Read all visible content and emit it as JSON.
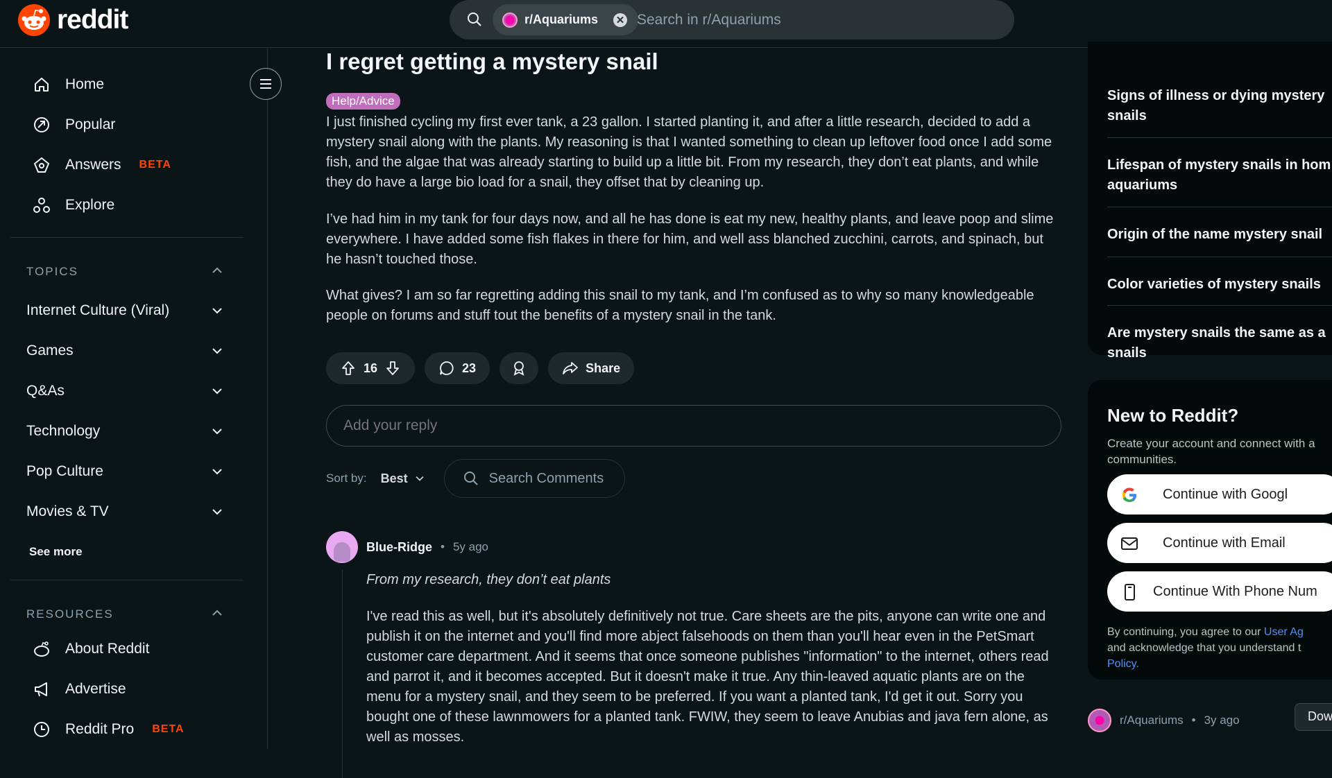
{
  "header": {
    "logo_text": "reddit",
    "search_chip": "r/Aquariums",
    "search_placeholder": "Search in r/Aquariums"
  },
  "sidebar": {
    "nav": [
      {
        "label": "Home",
        "icon": "home-icon"
      },
      {
        "label": "Popular",
        "icon": "popular-icon"
      },
      {
        "label": "Answers",
        "badge": "BETA",
        "icon": "answers-icon"
      },
      {
        "label": "Explore",
        "icon": "explore-icon"
      }
    ],
    "topics_title": "TOPICS",
    "topics": [
      "Internet Culture (Viral)",
      "Games",
      "Q&As",
      "Technology",
      "Pop Culture",
      "Movies & TV"
    ],
    "see_more": "See more",
    "resources_title": "RESOURCES",
    "resources": [
      {
        "label": "About Reddit",
        "icon": "reddit-alien-icon"
      },
      {
        "label": "Advertise",
        "icon": "megaphone-icon"
      },
      {
        "label": "Reddit Pro",
        "badge": "BETA",
        "icon": "reddit-pro-icon"
      }
    ]
  },
  "post": {
    "title": "I regret getting a mystery snail",
    "flair": "Help/Advice",
    "paragraphs": [
      "I just finished cycling my first ever tank, a 23 gallon. I started planting it, and after a little research, decided to add a mystery snail along with the plants. My reasoning is that I wanted something to clean up leftover food once I add some fish, and the algae that was already starting to build up a little bit. From my research, they don’t eat plants, and while they do have a large bio load for a snail, they offset that by cleaning up.",
      "I’ve had him in my tank for four days now, and all he has done is eat my new, healthy plants, and leave poop and slime everywhere. I have added some fish flakes in there for him, and well ass blanched zucchini, carrots, and spinach, but he hasn’t touched those.",
      "What gives? I am so far regretting adding this snail to my tank, and I’m confused as to why so many knowledgeable people on forums and stuff tout the benefits of a mystery snail in the tank."
    ],
    "votes": "16",
    "comments": "23",
    "share_label": "Share",
    "reply_placeholder": "Add your reply",
    "sort_label": "Sort by:",
    "sort_value": "Best",
    "search_comments": "Search Comments"
  },
  "comment": {
    "author": "Blue-Ridge",
    "sep": "•",
    "time": "5y ago",
    "quote": "From my research, they don’t eat plants",
    "body": "I've read this as well, but it's absolutely definitively not true. Care sheets are the pits, anyone can write one and publish it on the internet and you'll find more abject falsehoods on them than you'll hear even in the PetSmart customer care department. And it seems that once someone publishes \"information\" to the internet, others read and parrot it, and it becomes accepted. But it doesn't make it true. Any thin-leaved aquatic plants are on the menu for a mystery snail, and they seem to be preferred. If you want a planted tank, I'd get it out. Sorry you bought one of these lawnmowers for a planted tank. FWIW, they seem to leave Anubias and java fern alone, as well as mosses."
  },
  "related": [
    {
      "line1": "Signs of illness or dying mystery",
      "line2": "snails"
    },
    {
      "line1": "Lifespan of mystery snails in hom",
      "line2": "aquariums"
    },
    {
      "line1": "Origin of the name mystery snail",
      "line2": ""
    },
    {
      "line1": "Color varieties of mystery snails",
      "line2": ""
    },
    {
      "line1": "Are mystery snails the same as a",
      "line2": "snails"
    }
  ],
  "new_to_reddit": {
    "title": "New to Reddit?",
    "sub_line1": "Create your account and connect with a",
    "sub_line2": "communities.",
    "google": "Continue with Googl",
    "email": "Continue with Email",
    "phone": "Continue With Phone Num",
    "terms_pre": "By continuing, you agree to our ",
    "terms_link": "User Ag",
    "terms_line2": "and acknowledge that you understand t",
    "policy_link": "Policy."
  },
  "footer_card": {
    "subreddit": "r/Aquariums",
    "sep": "•",
    "time": "3y ago",
    "button": "Dow"
  },
  "colors": {
    "background": "#0b1416",
    "accent": "#ff4500",
    "flair": "#c06dbc",
    "link": "#4f8fff"
  }
}
